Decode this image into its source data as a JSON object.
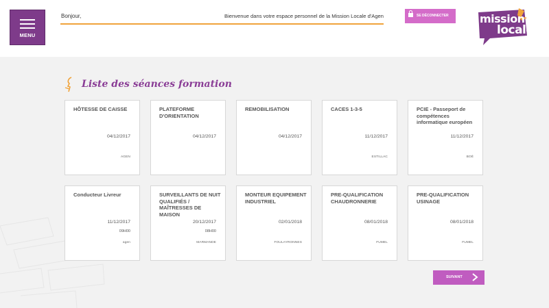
{
  "header": {
    "menu_label": "MENU",
    "greeting": "Bonjour,",
    "welcome": "Bienvenue dans votre espace personnel de la Mission Locale d'Agen",
    "logout_label": "SE DÉCONNECTER",
    "logo_line1": "mission",
    "logo_line2": "locale"
  },
  "main": {
    "title": "Liste des séances formation",
    "cards": [
      {
        "title": "HÔTESSE DE CAISSE",
        "date": "04/12/2017",
        "time": "",
        "place": "AGEN"
      },
      {
        "title": "PLATEFORME D'ORIENTATION",
        "date": "04/12/2017",
        "time": "",
        "place": ""
      },
      {
        "title": "REMOBILISATION",
        "date": "04/12/2017",
        "time": "",
        "place": ""
      },
      {
        "title": "CACES 1-3-5",
        "date": "11/12/2017",
        "time": "",
        "place": "ESTILLAC"
      },
      {
        "title": "PCIE - Passeport de compétences informatique européen",
        "date": "11/12/2017",
        "time": "",
        "place": "BOÉ"
      },
      {
        "title": "Conducteur Livreur",
        "date": "11/12/2017",
        "time": "09H00",
        "place": "agen"
      },
      {
        "title": "SURVEILLANTS DE NUIT QUALIFIÉS / MAÎTRESSES DE MAISON",
        "date": "20/12/2017",
        "time": "08H00",
        "place": "MARMANDE"
      },
      {
        "title": "MONTEUR EQUIPEMENT INDUSTRIEL",
        "date": "02/01/2018",
        "time": "",
        "place": "FOULAYRONNES"
      },
      {
        "title": "PRE-QUALIFICATION CHAUDRONNERIE",
        "date": "08/01/2018",
        "time": "",
        "place": "FUMEL"
      },
      {
        "title": "PRE-QUALIFICATION USINAGE",
        "date": "08/01/2018",
        "time": "",
        "place": "FUMEL"
      }
    ],
    "next_label": "SUIVANT"
  },
  "colors": {
    "brand_purple": "#7e3b8a",
    "accent_orange": "#f0a33a",
    "button_pink": "#d46cc9"
  }
}
